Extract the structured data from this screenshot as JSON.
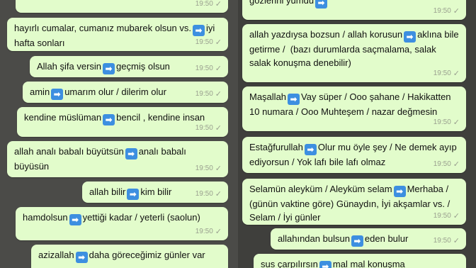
{
  "arrow_glyph": "➡",
  "check_glyph": "✓",
  "colors": {
    "bubble": "#e2fccb",
    "arrow_icon": "#3d8fe0",
    "meta_text": "#9aa08f"
  },
  "left_messages": [
    {
      "time": "19:50"
    },
    {
      "before": "hayırlı cumalar, cumanız mubarek olsun vs.",
      "after": "iyi hafta sonları",
      "time": "19:50"
    },
    {
      "before": "Allah şifa versin",
      "after": "geçmiş olsun",
      "time": "19:50"
    },
    {
      "before": "amin",
      "after": "umarım olur / dilerim olur",
      "time": "19:50"
    },
    {
      "before": "kendine müslüman",
      "after": "bencil , kendine insan",
      "time": "19:50"
    },
    {
      "before": "allah analı babalı büyütsün",
      "after": "analı babalı büyüsün",
      "time": "19:50"
    },
    {
      "before": "allah bilir",
      "after": "kim bilir",
      "time": "19:50"
    },
    {
      "before": "hamdolsun",
      "after": "yettiği kadar / yeterli (saolun)",
      "time": "19:50"
    },
    {
      "before": "azizallah",
      "after": "daha göreceğimiz günler var",
      "time": ""
    }
  ],
  "right_messages": [
    {
      "before": "gözlerini yumdu",
      "after": "",
      "time": "19:50"
    },
    {
      "before": "allah yazdıysa bozsun / allah korusun",
      "after": "aklına bile getirme /  (bazı durumlarda saçmalama, salak salak konuşma denebilir)",
      "time": "19:50"
    },
    {
      "before": "Maşallah",
      "after": "Vay süper / Ooo şahane / Hakikatten 10 numara / Ooo Muhteşem / nazar değmesin",
      "time": "19:50"
    },
    {
      "before": "Estağfurullah",
      "after": "Olur mu öyle şey / Ne demek ayıp ediyorsun / Yok lafı bile lafı olmaz",
      "time": "19:50"
    },
    {
      "before": "Selamün aleyküm / Aleyküm selam",
      "after": "Merhaba / (günün vaktine göre) Günaydın, İyi akşamlar vs. / Selam / İyi günler",
      "time": "19:50"
    },
    {
      "before": "allahından bulsun",
      "after": "eden bulur",
      "time": "19:50"
    },
    {
      "before": "sus çarpılırsın",
      "after": "mal mal konuşma",
      "time": ""
    }
  ]
}
